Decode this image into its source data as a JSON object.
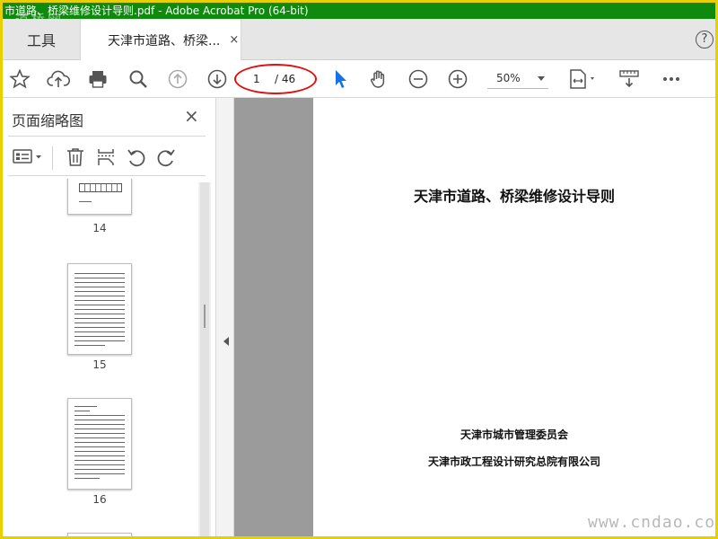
{
  "window": {
    "title": "市道路、桥梁维修设计导则.pdf - Adobe Acrobat Pro (64-bit)"
  },
  "watermark_top": "道桥网",
  "watermark_bottom": "www.cndao.com",
  "tabs": {
    "tools_label": "工具",
    "doc_label": "天津市道路、桥梁...",
    "close_glyph": "×",
    "help_glyph": "?"
  },
  "toolbar": {
    "page_current": "1",
    "page_total": "/ 46",
    "zoom_value": "50%"
  },
  "sidebar": {
    "title": "页面缩略图",
    "close_glyph": "×",
    "thumbnails": [
      {
        "page": "14"
      },
      {
        "page": "15"
      },
      {
        "page": "16"
      }
    ]
  },
  "document": {
    "title": "天津市道路、桥梁维修设计导则",
    "org1": "天津市城市管理委员会",
    "org2": "天津市政工程设计研究总院有限公司"
  },
  "colors": {
    "titlebar": "#0f8a0f",
    "select_tool": "#1473e6",
    "annotation": "#e01010",
    "frame": "#e8d000"
  }
}
